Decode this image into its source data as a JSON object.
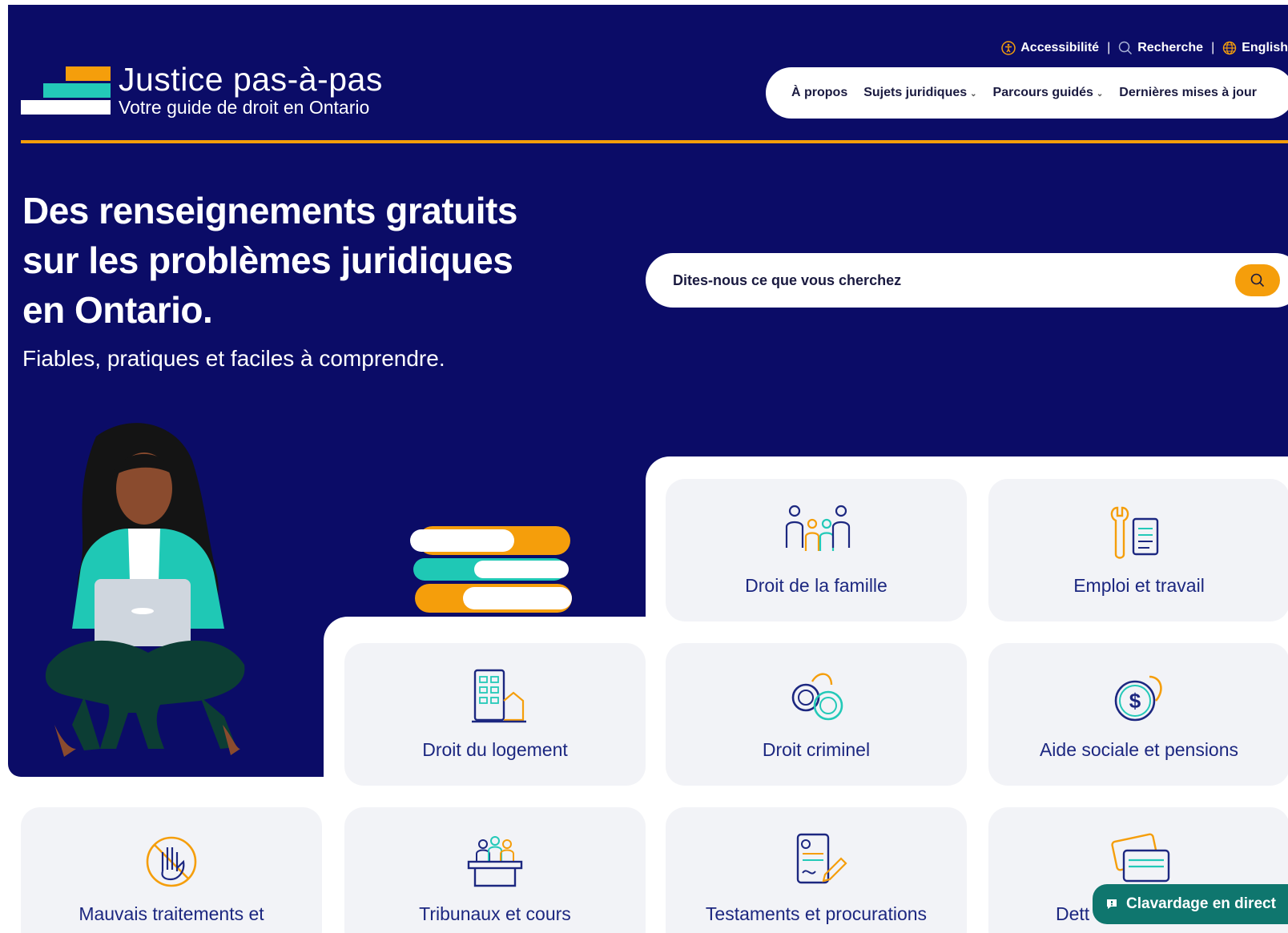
{
  "logo": {
    "name": "Justice pas-à-pas",
    "tagline": "Votre guide de droit en Ontario"
  },
  "utility": {
    "accessibility": "Accessibilité",
    "search": "Recherche",
    "language": "English"
  },
  "nav": {
    "about": "À propos",
    "topics": "Sujets juridiques",
    "guided": "Parcours guidés",
    "updates": "Dernières mises à jour"
  },
  "hero": {
    "headline": "Des renseignements gratuits sur les problèmes juridiques en Ontario.",
    "subhead": "Fiables, pratiques et faciles à comprendre."
  },
  "search": {
    "placeholder": "Dites-nous ce que vous cherchez"
  },
  "cards": [
    {
      "label": "Droit de la famille",
      "icon": "family-icon"
    },
    {
      "label": "Emploi et travail",
      "icon": "work-tools-icon"
    },
    {
      "label": "Droit du logement",
      "icon": "housing-icon"
    },
    {
      "label": "Droit criminel",
      "icon": "handcuffs-icon"
    },
    {
      "label": "Aide sociale et pensions",
      "icon": "dollar-coin-icon"
    },
    {
      "label": "Mauvais traitements et",
      "icon": "stop-hand-icon"
    },
    {
      "label": "Tribunaux et cours",
      "icon": "tribunal-icon"
    },
    {
      "label": "Testaments et procurations",
      "icon": "will-document-icon"
    },
    {
      "label": "Dett",
      "icon": "credit-card-icon"
    }
  ],
  "chat": {
    "label": "Clavardage en direct"
  },
  "colors": {
    "navy": "#0b0c67",
    "accent": "#f59e0b",
    "teal": "#23c9b8",
    "chat": "#0f766e"
  }
}
